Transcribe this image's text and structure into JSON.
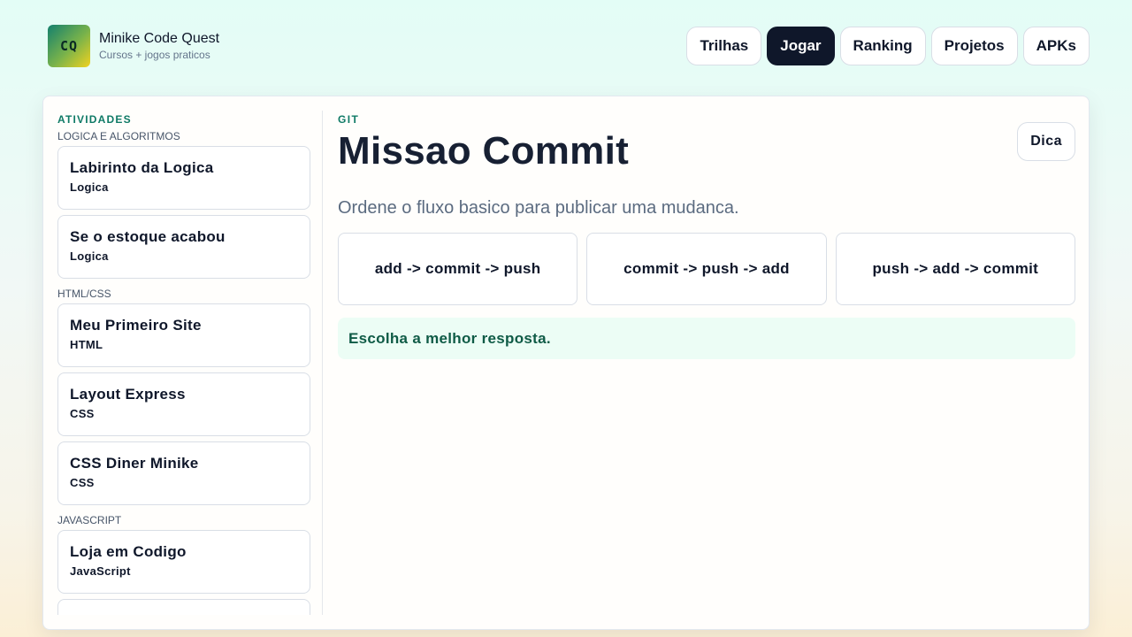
{
  "brand": {
    "logo_text": "CQ",
    "title": "Minike Code Quest",
    "subtitle": "Cursos + jogos praticos"
  },
  "nav": {
    "items": [
      {
        "label": "Trilhas",
        "active": false
      },
      {
        "label": "Jogar",
        "active": true
      },
      {
        "label": "Ranking",
        "active": false
      },
      {
        "label": "Projetos",
        "active": false
      },
      {
        "label": "APKs",
        "active": false
      }
    ]
  },
  "sidebar": {
    "heading": "ATIVIDADES",
    "groups": [
      {
        "label": "LOGICA E ALGORITMOS",
        "items": [
          {
            "title": "Labirinto da Logica",
            "tag": "Logica"
          },
          {
            "title": "Se o estoque acabou",
            "tag": "Logica"
          }
        ]
      },
      {
        "label": "HTML/CSS",
        "items": [
          {
            "title": "Meu Primeiro Site",
            "tag": "HTML"
          },
          {
            "title": "Layout Express",
            "tag": "CSS"
          },
          {
            "title": "CSS Diner Minike",
            "tag": "CSS"
          }
        ]
      },
      {
        "label": "JAVASCRIPT",
        "items": [
          {
            "title": "Loja em Codigo",
            "tag": "JavaScript"
          }
        ]
      }
    ]
  },
  "content": {
    "category": "GIT",
    "title": "Missao Commit",
    "hint_label": "Dica",
    "prompt": "Ordene o fluxo basico para publicar uma mudanca.",
    "options": [
      "add -> commit -> push",
      "commit -> push -> add",
      "push -> add -> commit"
    ],
    "feedback": "Escolha a melhor resposta."
  },
  "colors": {
    "accent": "#0f7a66",
    "active_nav": "#0f172a",
    "feedback_bg": "#ecfdf5",
    "feedback_text": "#0f5b46"
  }
}
